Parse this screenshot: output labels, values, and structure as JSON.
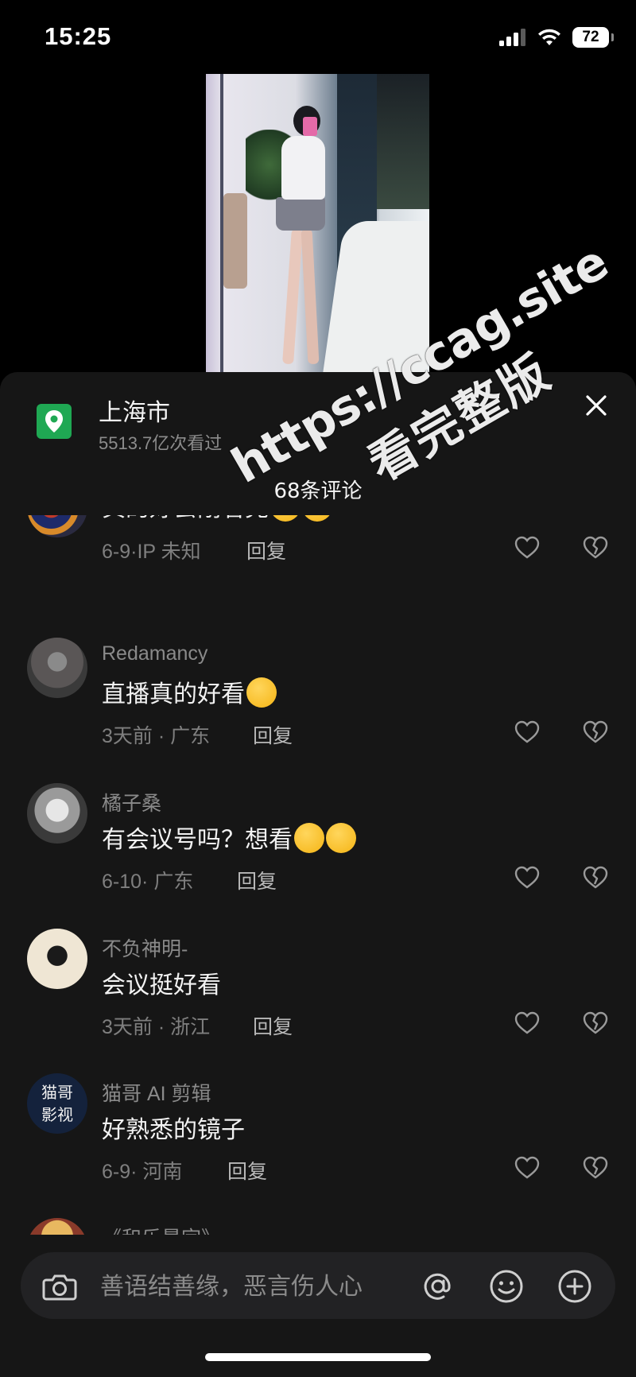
{
  "status": {
    "time": "15:25",
    "battery": "72"
  },
  "watermark": {
    "line1": "https://ccag.site",
    "line2": "看完整版"
  },
  "location": {
    "name": "上海市",
    "views": "5513.7亿次看过"
  },
  "comment_count": "68条评论",
  "comments": [
    {
      "author": "",
      "text": "真的好会刚看完",
      "date": "6-9",
      "region": "IP 未知",
      "reply": "回复",
      "emojis": 2,
      "emoji_kind": "smirk"
    },
    {
      "author": "Redamancy",
      "text": "直播真的好看",
      "date": "3天前",
      "region": "广东",
      "reply": "回复",
      "emojis": 1,
      "emoji_kind": "grin"
    },
    {
      "author": "橘子桑",
      "text": "有会议号吗？想看",
      "date": "6-10",
      "region": "广东",
      "reply": "回复",
      "emojis": 2,
      "emoji_kind": "cry"
    },
    {
      "author": "不负神明-",
      "text": "会议挺好看",
      "date": "3天前",
      "region": "浙江",
      "reply": "回复",
      "emojis": 0,
      "emoji_kind": ""
    },
    {
      "author": "猫哥 AI 剪辑",
      "text": "好熟悉的镜子",
      "date": "6-9",
      "region": "河南",
      "reply": "回复",
      "emojis": 0,
      "emoji_kind": "",
      "avatar_text": [
        "猫哥",
        "影视"
      ]
    },
    {
      "author": "《和乐最宗》",
      "text": "",
      "date": "",
      "region": "",
      "reply": "",
      "emojis": 0,
      "emoji_kind": ""
    }
  ],
  "input": {
    "placeholder": "善语结善缘，恶言伤人心"
  },
  "icons": {
    "location": "map-pin-icon",
    "close": "close-icon",
    "like": "heart-outline-icon",
    "dislike": "broken-heart-icon",
    "camera": "camera-icon",
    "mention": "at-icon",
    "emoji": "smiley-icon",
    "add": "plus-circle-icon"
  },
  "colors": {
    "sheet": "#161616",
    "location_badge": "#1fa853",
    "muted_text": "#8a8a8a"
  }
}
